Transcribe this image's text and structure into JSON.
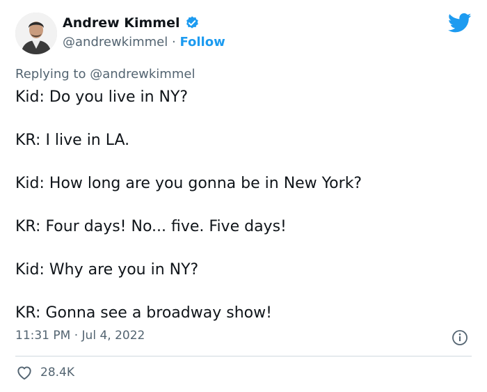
{
  "user": {
    "display_name": "Andrew Kimmel",
    "handle": "@andrewkimmel",
    "separator": "·",
    "follow_label": "Follow",
    "verified": true
  },
  "icons": {
    "brand": "twitter-bird-icon",
    "verified": "verified-badge-icon",
    "info": "info-icon",
    "like": "heart-icon"
  },
  "colors": {
    "accent": "#1d9bf0",
    "text": "#0f1419",
    "secondary": "#536471"
  },
  "reply": {
    "prefix": "Replying to",
    "mention": "@andrewkimmel"
  },
  "tweet": {
    "lines": [
      "Kid: Do you live in NY?",
      "KR: I live in LA.",
      "Kid: How long are you gonna be in New York?",
      "KR: Four days! No... five. Five days!",
      "Kid: Why are you in NY?",
      "KR: Gonna see a broadway show!"
    ]
  },
  "meta": {
    "time": "11:31 PM",
    "separator": "·",
    "date": "Jul 4, 2022"
  },
  "engagement": {
    "likes": "28.4K"
  }
}
